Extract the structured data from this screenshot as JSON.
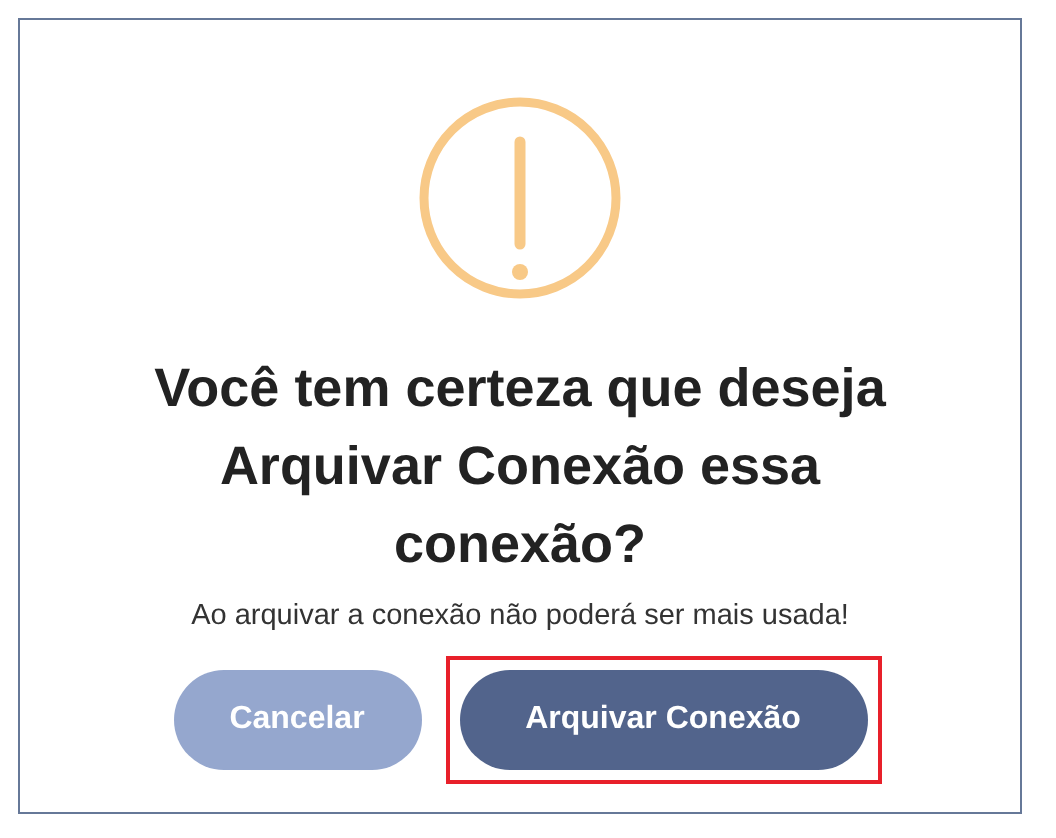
{
  "dialog": {
    "title_lines": [
      "Você tem certeza que deseja",
      "Arquivar Conexão essa",
      "conexão?"
    ],
    "message": "Ao arquivar a conexão não poderá ser mais usada!",
    "buttons": [
      {
        "label": "Cancelar",
        "kind": "secondary",
        "highlighted": false
      },
      {
        "label": "Arquivar Conexão",
        "kind": "primary",
        "highlighted": true
      }
    ]
  }
}
